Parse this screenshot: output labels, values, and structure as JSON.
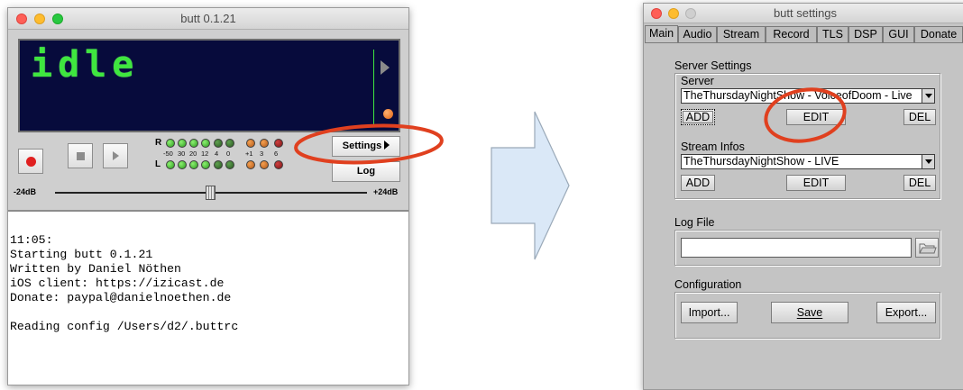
{
  "butt_window": {
    "title": "butt 0.1.21",
    "display_text": "idle",
    "vu": {
      "right_label": "R",
      "left_label": "L",
      "scale": [
        "-50",
        "30",
        "20",
        "12",
        "4",
        "0",
        "+1",
        "3",
        "6"
      ]
    },
    "settings_label": "Settings",
    "log_label": "Log",
    "volume_min_label": "-24dB",
    "volume_max_label": "+24dB",
    "volume_level": 0.5,
    "log_lines": [
      "11:05:",
      "Starting butt 0.1.21",
      "Written by Daniel Nöthen",
      "iOS client: https://izicast.de",
      "Donate: paypal@danielnoethen.de",
      "",
      "Reading config /Users/d2/.buttrc"
    ]
  },
  "settings_window": {
    "title": "butt settings",
    "tabs": [
      "Main",
      "Audio",
      "Stream",
      "Record",
      "TLS",
      "DSP",
      "GUI",
      "Donate"
    ],
    "active_tab": "Main",
    "server_settings": {
      "group_label": "Server Settings",
      "server_label": "Server",
      "server_value": "TheThursdayNightShow - VoiceofDoom - Live",
      "add_label": "ADD",
      "edit_label": "EDIT",
      "del_label": "DEL",
      "stream_infos_label": "Stream Infos",
      "stream_infos_value": "TheThursdayNightShow - LIVE",
      "stream_add_label": "ADD",
      "stream_edit_label": "EDIT",
      "stream_del_label": "DEL"
    },
    "log_file": {
      "label": "Log File",
      "value": ""
    },
    "configuration": {
      "label": "Configuration",
      "import_label": "Import...",
      "save_label": "Save",
      "export_label": "Export..."
    }
  },
  "colors": {
    "lcd_text": "#3fe63f",
    "lcd_background": "#070b3c",
    "annotation": "#e0401f",
    "arrow_fill": "#dae8f7"
  }
}
